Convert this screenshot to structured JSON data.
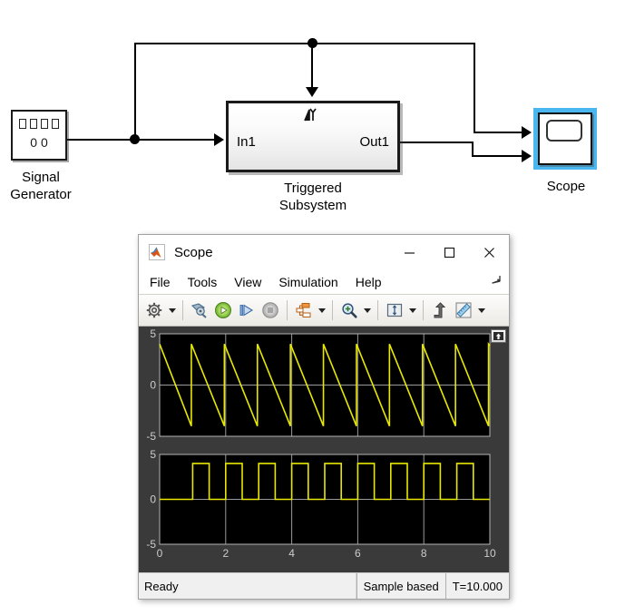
{
  "diagram": {
    "signal_generator": {
      "name": "signal-generator-block",
      "label": "Signal\nGenerator",
      "icon_value": "0 0",
      "glyph_count": 4
    },
    "triggered_subsystem": {
      "name": "triggered-subsystem-block",
      "label": "Triggered\nSubsystem",
      "in_port_label": "In1",
      "out_port_label": "Out1",
      "trigger_icon": "rising-edge-trigger-icon"
    },
    "scope_block": {
      "name": "scope-block",
      "label": "Scope",
      "selected": true,
      "selection_color": "#4ab6f0"
    },
    "wire_color": "#000000"
  },
  "scope_window": {
    "title": "Scope",
    "app_icon": "matlab-logo-icon",
    "window_controls": {
      "minimize": "minimize-button",
      "maximize": "maximize-button",
      "close": "close-button"
    },
    "menu": [
      "File",
      "Tools",
      "View",
      "Simulation",
      "Help"
    ],
    "undock_icon": "undock-arrow-icon",
    "toolbar": [
      {
        "name": "configuration-properties-button",
        "icon": "gear-icon",
        "has_dropdown": true
      },
      {
        "separator": true
      },
      {
        "name": "simulink-model-button",
        "icon": "simulink-model-icon",
        "has_dropdown": false
      },
      {
        "name": "run-button",
        "icon": "play-icon",
        "has_dropdown": false
      },
      {
        "name": "step-forward-button",
        "icon": "step-forward-icon",
        "has_dropdown": false
      },
      {
        "name": "stop-button",
        "icon": "stop-icon",
        "has_dropdown": false,
        "disabled": true
      },
      {
        "separator": true
      },
      {
        "name": "signal-selection-button",
        "icon": "signal-hierarchy-icon",
        "has_dropdown": true
      },
      {
        "separator": true
      },
      {
        "name": "zoom-button",
        "icon": "zoom-in-icon",
        "has_dropdown": true
      },
      {
        "separator": true
      },
      {
        "name": "autoscale-button",
        "icon": "autoscale-icon",
        "has_dropdown": true
      },
      {
        "separator": true
      },
      {
        "name": "cursor-measurement-button",
        "icon": "cursor-measure-icon",
        "has_dropdown": false
      },
      {
        "name": "measurements-button",
        "icon": "ruler-icon",
        "has_dropdown": true
      }
    ],
    "fit_to_view_button": "fit-to-view-icon",
    "status_bar": {
      "status": "Ready",
      "mode": "Sample based",
      "time": "T=10.000"
    }
  },
  "chart_data": [
    {
      "type": "line",
      "title": "",
      "subplot_index": 1,
      "name": "sawtooth-signal",
      "xlabel": "",
      "ylabel": "",
      "xlim": [
        0,
        10
      ],
      "ylim": [
        -5,
        5
      ],
      "xticks": [
        0,
        2,
        4,
        6,
        8,
        10
      ],
      "yticks": [
        -5,
        0,
        5
      ],
      "ytick_labels": [
        "-5",
        "0",
        "5"
      ],
      "xtick_labels": [
        "",
        "",
        "",
        "",
        "",
        ""
      ],
      "grid": true,
      "background": "#000000",
      "line_color": "#e8e800",
      "series": [
        {
          "name": "Signal Generator sawtooth",
          "description": "Descending sawtooth, amplitude 4, period 1 s, 10 cycles over 0 to 10 s",
          "amplitude": 4,
          "period": 1.0,
          "waveform": "sawtooth-descending",
          "x": [
            0,
            0.96,
            0.96,
            1.96,
            1.96,
            2.96,
            2.96,
            3.96,
            3.96,
            4.96,
            4.96,
            5.96,
            5.96,
            6.96,
            6.96,
            7.96,
            7.96,
            8.96,
            8.96,
            9.96,
            9.96,
            10
          ],
          "values": [
            4,
            -4,
            4,
            -4,
            4,
            -4,
            4,
            -4,
            4,
            -4,
            4,
            -4,
            4,
            -4,
            4,
            -4,
            4,
            -4,
            4,
            -4,
            4,
            3.84
          ]
        }
      ]
    },
    {
      "type": "line",
      "title": "",
      "subplot_index": 2,
      "name": "pulse-signal",
      "xlabel": "",
      "ylabel": "",
      "xlim": [
        0,
        10
      ],
      "ylim": [
        -5,
        5
      ],
      "xticks": [
        0,
        2,
        4,
        6,
        8,
        10
      ],
      "yticks": [
        -5,
        0,
        5
      ],
      "ytick_labels": [
        "-5",
        "0",
        "5"
      ],
      "xtick_labels": [
        "0",
        "2",
        "4",
        "6",
        "8",
        "10"
      ],
      "grid": true,
      "background": "#000000",
      "line_color": "#e8e800",
      "series": [
        {
          "name": "Triggered Subsystem output pulse train",
          "description": "Zero-order-hold pulse train, low 0, high 4, first rise at t=1, pulse width 0.5, period 1",
          "low": 0,
          "high": 4,
          "first_rise": 1.0,
          "pulse_width": 0.5,
          "period": 1.0,
          "x": [
            0,
            1,
            1,
            1.5,
            1.5,
            2,
            2,
            2.5,
            2.5,
            3,
            3,
            3.5,
            3.5,
            4,
            4,
            4.5,
            4.5,
            5,
            5,
            5.5,
            5.5,
            6,
            6,
            6.5,
            6.5,
            7,
            7,
            7.5,
            7.5,
            8,
            8,
            8.5,
            8.5,
            9,
            9,
            9.5,
            9.5,
            10
          ],
          "values": [
            0,
            0,
            4,
            4,
            0,
            0,
            4,
            4,
            0,
            0,
            4,
            4,
            0,
            0,
            4,
            4,
            0,
            0,
            4,
            4,
            0,
            0,
            4,
            4,
            0,
            0,
            4,
            4,
            0,
            0,
            4,
            4,
            0,
            0,
            4,
            4,
            0,
            0
          ]
        }
      ]
    }
  ]
}
